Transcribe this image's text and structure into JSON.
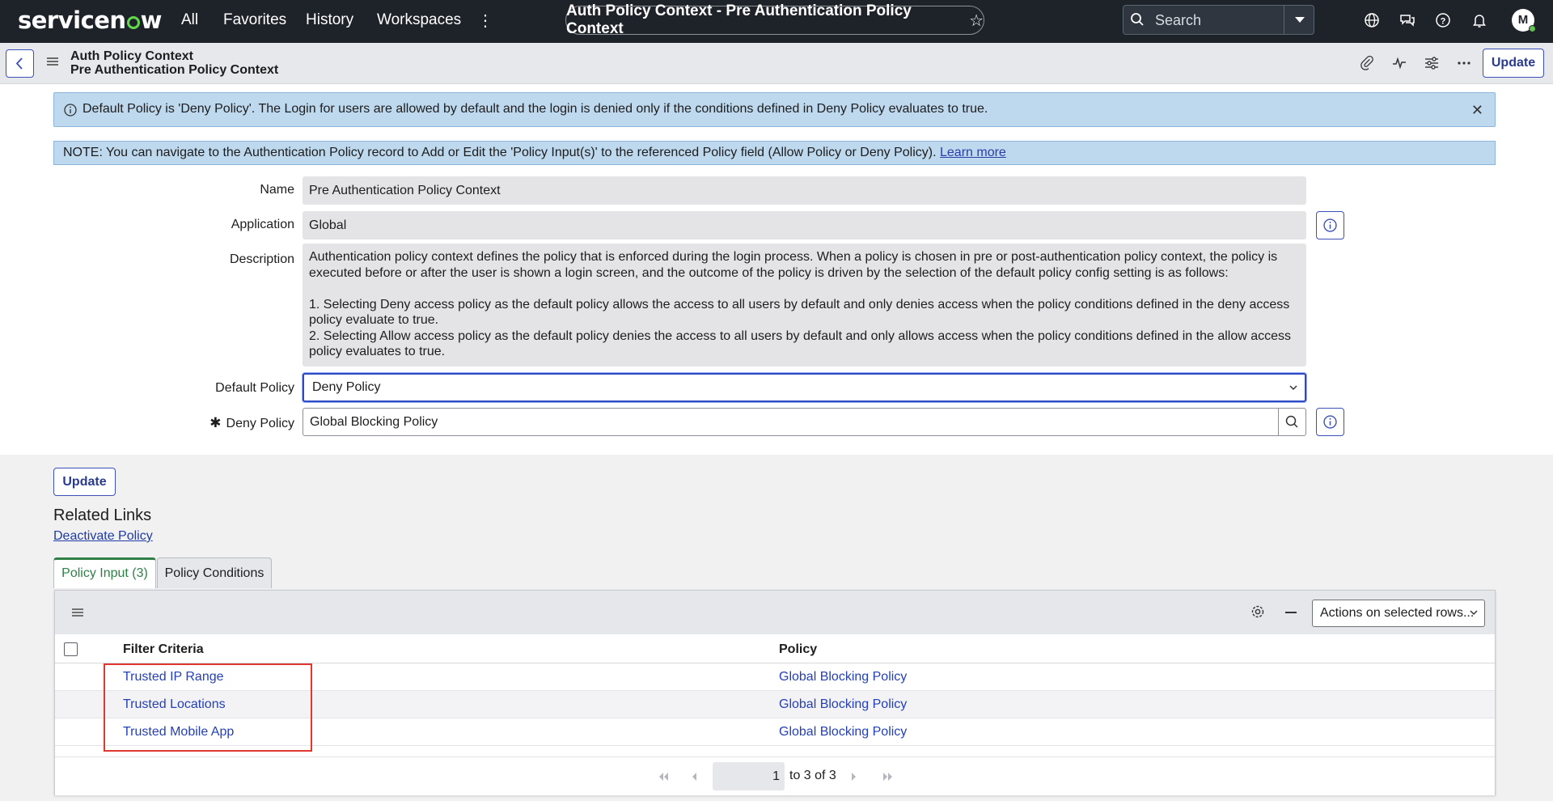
{
  "topnav": {
    "logo": "servicenow",
    "links": [
      "All",
      "Favorites",
      "History",
      "Workspaces"
    ],
    "record_title": "Auth Policy Context - Pre Authentication Policy Context",
    "search_placeholder": "Search",
    "avatar_initial": "M"
  },
  "header": {
    "table_name": "Auth Policy Context",
    "record_name": "Pre Authentication Policy Context",
    "update_label": "Update"
  },
  "banners": {
    "info": "Default Policy is 'Deny Policy'. The Login for users are allowed by default and the login is denied only if the conditions defined in Deny Policy evaluates to true.",
    "note": "NOTE: You can navigate to the Authentication Policy record to Add or Edit the 'Policy Input(s)' to the referenced Policy field (Allow Policy or Deny Policy).",
    "learn_more": "Learn more"
  },
  "form": {
    "name_label": "Name",
    "name_value": "Pre Authentication Policy Context",
    "application_label": "Application",
    "application_value": "Global",
    "description_label": "Description",
    "description_p1": "Authentication policy context defines the policy that is enforced during the login process. When a policy is chosen in pre or post-authentication policy context, the policy is executed before or after the user is shown a login screen, and the outcome of the policy is driven by the selection of the default policy config setting is as follows:",
    "description_p2": "1. Selecting Deny access policy as the default policy allows the access to all users by default and only denies access when the policy conditions defined in the deny access policy evaluate to true.",
    "description_p3": "2. Selecting Allow access policy as the default policy denies the access to all users by default and only allows access when the policy conditions defined in the allow access policy evaluates to true.",
    "default_policy_label": "Default Policy",
    "default_policy_value": "Deny Policy",
    "deny_policy_label": "Deny Policy",
    "deny_policy_value": "Global Blocking Policy"
  },
  "related": {
    "update_label": "Update",
    "title": "Related Links",
    "deactivate": "Deactivate Policy"
  },
  "tabs": {
    "active": "Policy Input (3)",
    "inactive": "Policy Conditions"
  },
  "list": {
    "actions_label": "Actions on selected rows...",
    "columns": [
      "Filter Criteria",
      "Policy"
    ],
    "rows": [
      {
        "filter": "Trusted IP Range",
        "policy": "Global Blocking Policy"
      },
      {
        "filter": "Trusted Locations",
        "policy": "Global Blocking Policy"
      },
      {
        "filter": "Trusted Mobile App",
        "policy": "Global Blocking Policy"
      }
    ],
    "page_value": "1",
    "page_text": "to 3 of 3"
  },
  "colors": {
    "nav_bg": "#1e2329",
    "accent_blue": "#3c50b9",
    "link_blue": "#2540b5",
    "banner_bg": "#bed8ee",
    "active_tab_green": "#2f8047",
    "highlight_red": "#e0382f"
  },
  "icons": [
    "search-icon",
    "globe-icon",
    "chat-icon",
    "help-icon",
    "bell-icon",
    "back-icon",
    "menu-icon",
    "paperclip-icon",
    "activity-icon",
    "sliders-icon",
    "more-icon",
    "info-icon",
    "close-icon",
    "chevron-down-icon",
    "gear-icon",
    "minus-icon",
    "first-page-icon",
    "prev-page-icon",
    "next-page-icon",
    "last-page-icon",
    "star-icon"
  ]
}
